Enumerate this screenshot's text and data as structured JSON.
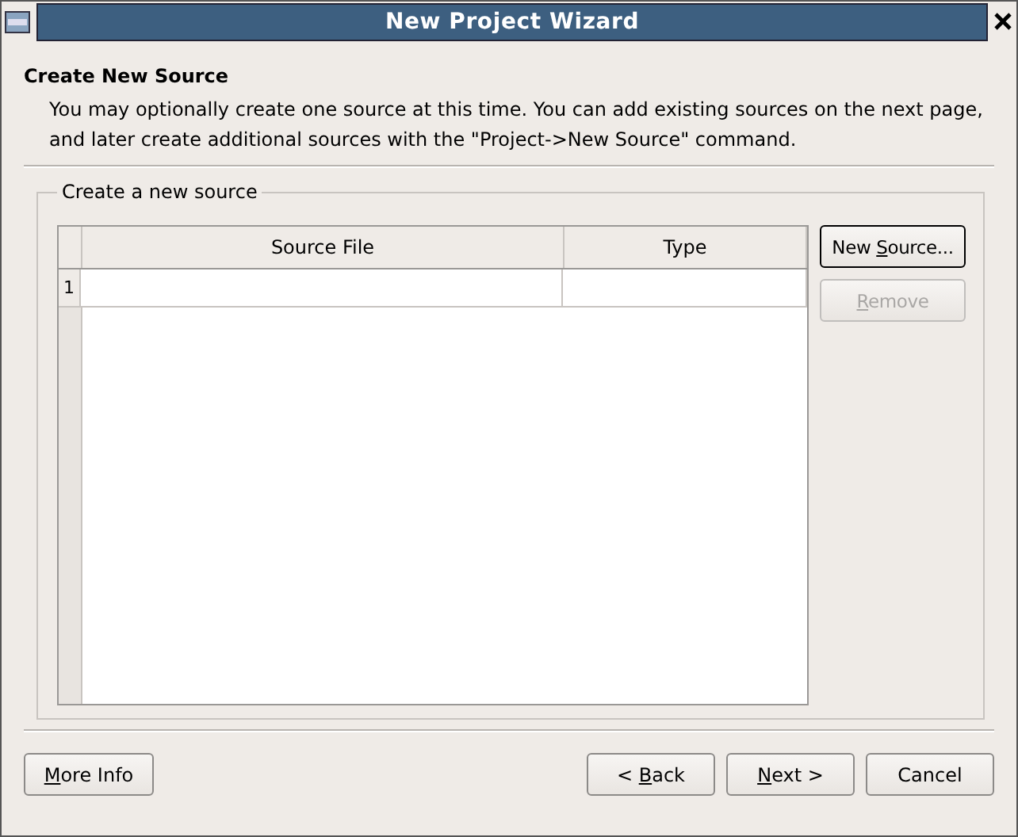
{
  "window": {
    "title": "New Project Wizard"
  },
  "page": {
    "heading": "Create New Source",
    "description_lines": [
      "You may optionally create one source at this time. You can add existing sources on the next page,",
      "and later create additional sources with the \"Project->New Source\" command."
    ]
  },
  "group": {
    "title": "Create a new source"
  },
  "table": {
    "columns": [
      "Source File",
      "Type"
    ],
    "rows": [
      {
        "row_header": "1"
      }
    ]
  },
  "side_buttons": [
    {
      "label": [
        {
          "text": "New ",
          "underlined": false
        },
        {
          "text": "S",
          "underlined": true
        },
        {
          "text": "ource...",
          "underlined": false
        }
      ],
      "default": true,
      "disabled": false
    },
    {
      "label": [
        {
          "text": "R",
          "underlined": true
        },
        {
          "text": "emove",
          "underlined": false
        }
      ],
      "default": false,
      "disabled": true
    }
  ],
  "footer_left": [
    {
      "label": [
        {
          "text": "M",
          "underlined": true
        },
        {
          "text": "ore Info",
          "underlined": false
        }
      ],
      "default": false,
      "disabled": false
    }
  ],
  "footer_right": [
    {
      "label": [
        {
          "text": "< ",
          "underlined": false
        },
        {
          "text": "B",
          "underlined": true
        },
        {
          "text": "ack",
          "underlined": false
        }
      ],
      "default": false,
      "disabled": false
    },
    {
      "label": [
        {
          "text": "N",
          "underlined": true
        },
        {
          "text": "ext >",
          "underlined": false
        }
      ],
      "default": false,
      "disabled": false
    },
    {
      "label": [
        {
          "text": "Cancel",
          "underlined": false
        }
      ],
      "default": false,
      "disabled": false
    }
  ]
}
